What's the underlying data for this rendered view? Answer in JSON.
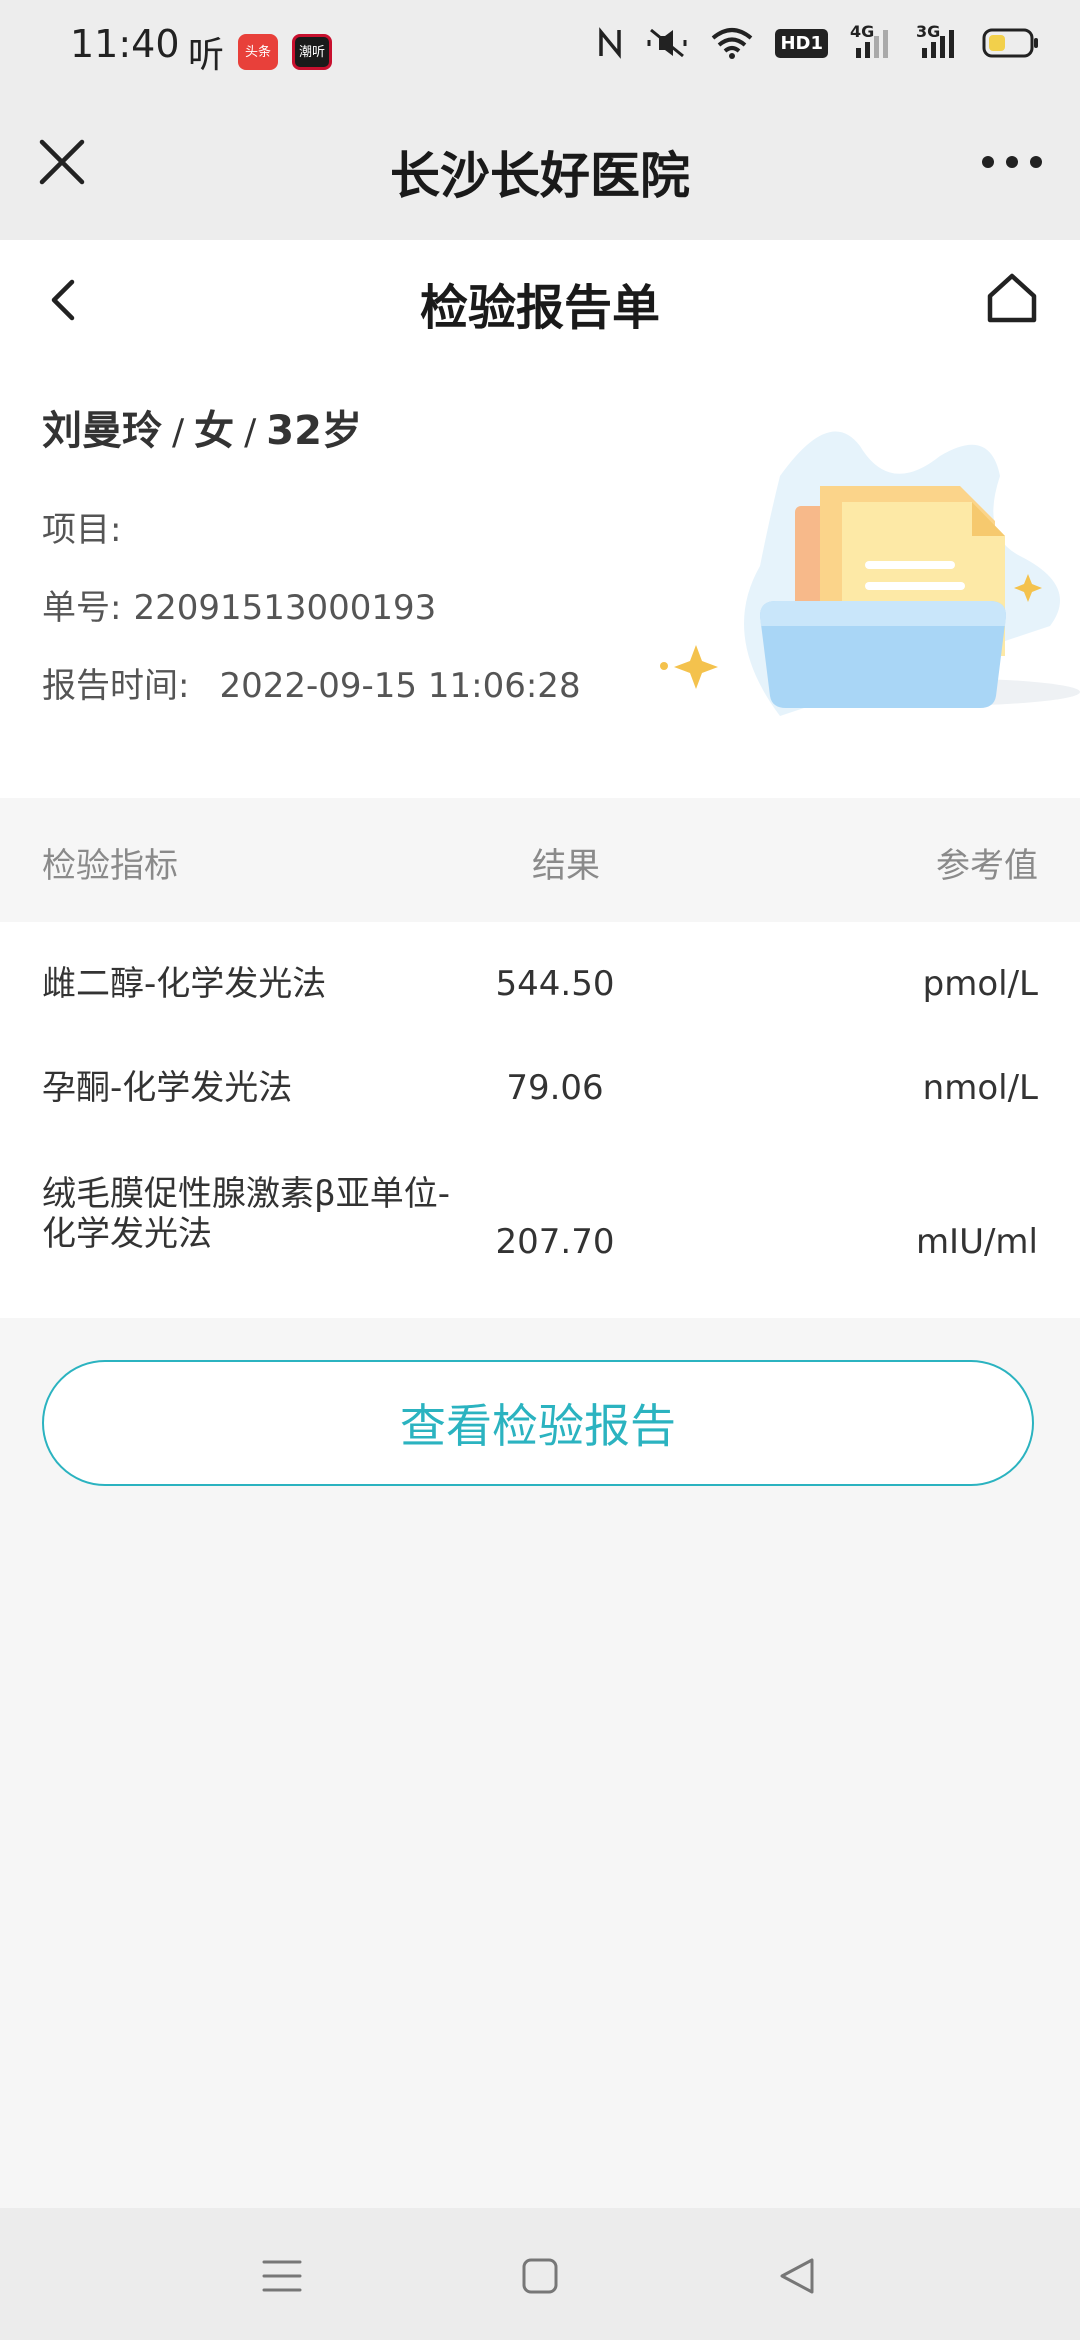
{
  "status_bar": {
    "time": "11:40",
    "ting_icon": "听",
    "app1_label": "头条",
    "app2_label": "潮听",
    "network_4g": "4G",
    "network_3g": "3G",
    "hd_label": "HD1"
  },
  "title_bar": {
    "title": "长沙长好医院"
  },
  "page_header": {
    "title": "检验报告单"
  },
  "patient": {
    "name": "刘曼玲",
    "sep1": "/",
    "gender": "女",
    "sep2": "/",
    "age": "32岁",
    "item_label": "项目:",
    "item_value": "",
    "no_label": "单号:",
    "no_value": "22091513000193",
    "time_label": "报告时间:",
    "time_value": "2022-09-15 11:06:28"
  },
  "table": {
    "headers": {
      "name": "检验指标",
      "result": "结果",
      "reference": "参考值"
    },
    "rows": [
      {
        "name": "雌二醇-化学发光法",
        "result": "544.50",
        "reference": "pmol/L"
      },
      {
        "name": "孕酮-化学发光法",
        "result": "79.06",
        "reference": "nmol/L"
      },
      {
        "name": "绒毛膜促性腺激素β亚单位-化学发光法",
        "result": "207.70",
        "reference": "mIU/ml"
      }
    ]
  },
  "actions": {
    "view_report_label": "查看检验报告"
  },
  "colors": {
    "accent": "#2bb3c0",
    "header_bg": "#ededed",
    "page_bg": "#f6f6f6",
    "app1": "#e8403a",
    "app2": "#c8102e",
    "battery_fill": "#f2d04b"
  },
  "icons": {
    "close": "close-icon",
    "more": "more-icon",
    "back": "chevron-left-icon",
    "home": "home-icon",
    "illustration": "document-folder-illustration"
  }
}
